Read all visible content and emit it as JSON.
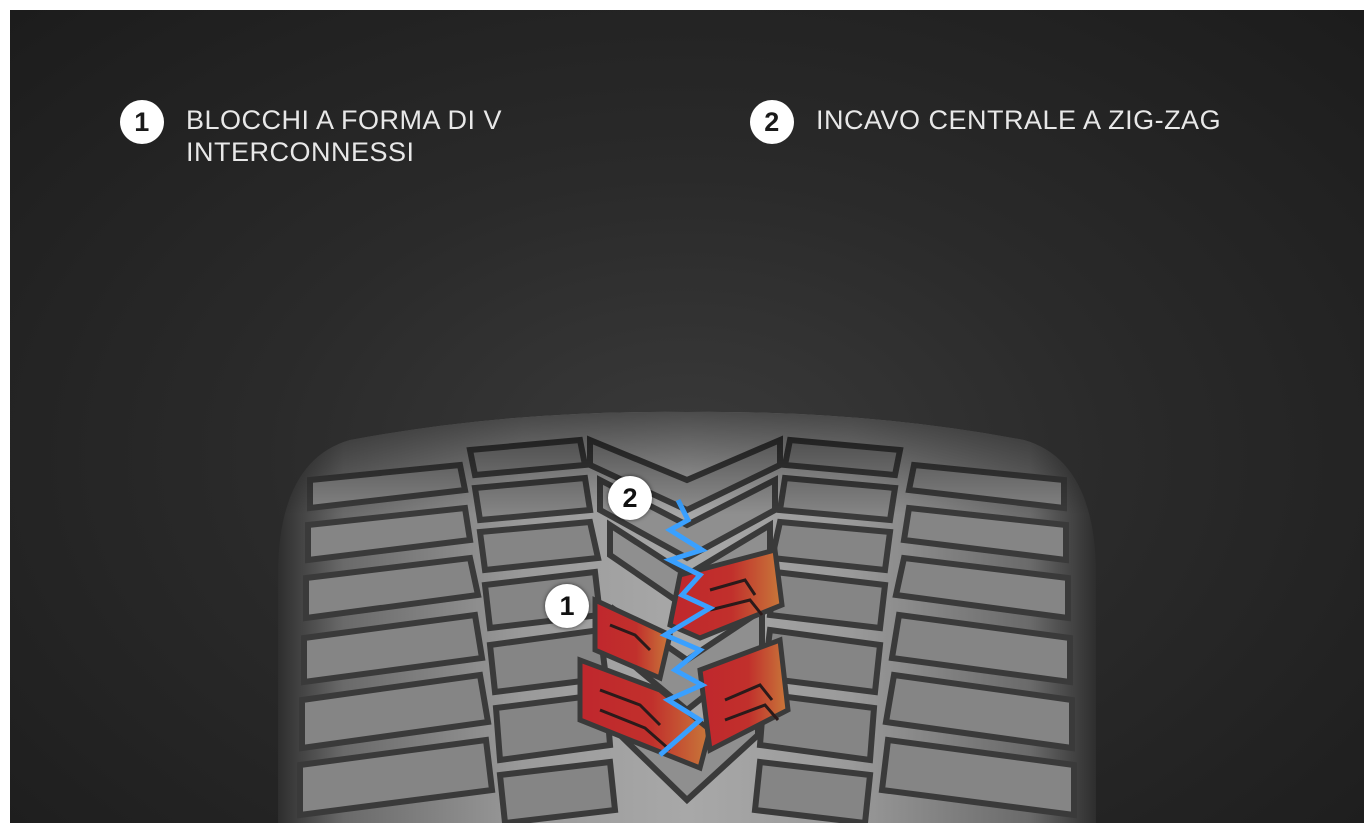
{
  "legend": [
    {
      "number": "1",
      "label": "BLOCCHI A FORMA DI V\nINTERCONNESSI"
    },
    {
      "number": "2",
      "label": "INCAVO CENTRALE A ZIG-ZAG"
    }
  ],
  "callouts": [
    {
      "number": "2"
    },
    {
      "number": "1"
    }
  ],
  "colors": {
    "background": "#2a2a2a",
    "tire": "#8c8c8c",
    "highlight_red": "#c0272d",
    "highlight_orange": "#c8703a",
    "groove_blue": "#3aa0ff",
    "text": "#e8e8e8"
  }
}
